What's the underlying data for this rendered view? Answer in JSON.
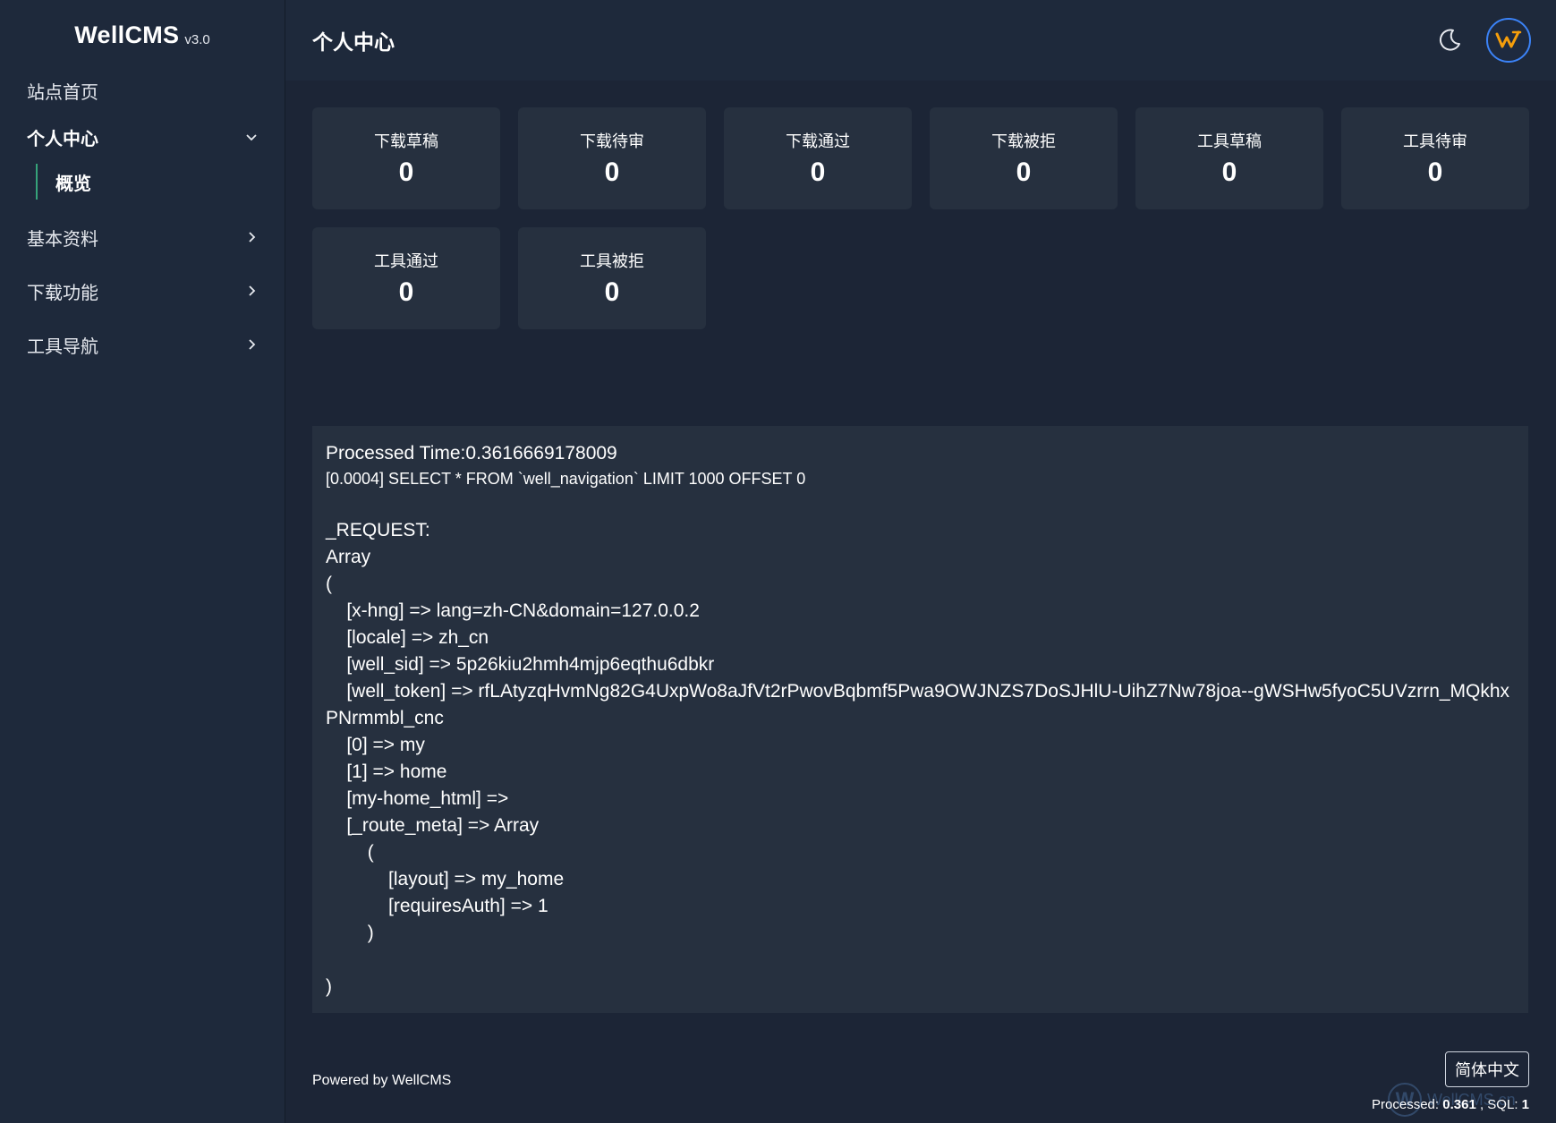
{
  "brand": {
    "name": "WellCMS",
    "version": "v3.0"
  },
  "sidebar": {
    "items": [
      {
        "label": "站点首页"
      },
      {
        "label": "个人中心",
        "sub": [
          {
            "label": "概览"
          }
        ]
      },
      {
        "label": "基本资料"
      },
      {
        "label": "下载功能"
      },
      {
        "label": "工具导航"
      }
    ]
  },
  "header": {
    "title": "个人中心"
  },
  "stats": [
    {
      "label": "下载草稿",
      "value": "0"
    },
    {
      "label": "下载待审",
      "value": "0"
    },
    {
      "label": "下载通过",
      "value": "0"
    },
    {
      "label": "下载被拒",
      "value": "0"
    },
    {
      "label": "工具草稿",
      "value": "0"
    },
    {
      "label": "工具待审",
      "value": "0"
    },
    {
      "label": "工具通过",
      "value": "0"
    },
    {
      "label": "工具被拒",
      "value": "0"
    }
  ],
  "debug": {
    "processed_time": "Processed Time:0.3616669178009",
    "sql": "[0.0004] SELECT * FROM `well_navigation` LIMIT 1000 OFFSET 0",
    "request_dump": "\n_REQUEST:\nArray\n(\n    [x-hng] => lang=zh-CN&domain=127.0.0.2\n    [locale] => zh_cn\n    [well_sid] => 5p26kiu2hmh4mjp6eqthu6dbkr\n    [well_token] => rfLAtyzqHvmNg82G4UxpWo8aJfVt2rPwovBqbmf5Pwa9OWJNZS7DoSJHlU-UihZ7Nw78joa--gWSHw5fyoC5UVzrrn_MQkhxPNrmmbl_cnc\n    [0] => my\n    [1] => home\n    [my-home_html] => \n    [_route_meta] => Array\n        (\n            [layout] => my_home\n            [requiresAuth] => 1\n        )\n\n)"
  },
  "footer": {
    "powered": "Powered by WellCMS",
    "language": "简体中文",
    "processed_label": "Processed: ",
    "processed_value": "0.361",
    "sql_label": " , SQL: ",
    "sql_value": "1",
    "watermark_letter": "W",
    "watermark_text": "WellCMS.cn"
  },
  "colors": {
    "sidebar_bg": "#1e293b",
    "main_bg": "#1c2536",
    "card_bg": "#26303f",
    "accent_green": "#36a37a",
    "avatar_ring": "#3b82f6",
    "logo_orange": "#f59e0b"
  },
  "icons": {
    "theme_toggle": "moon-icon",
    "avatar": "wellcms-logo-icon",
    "expand": "chevron-down-icon",
    "collapse": "chevron-right-icon"
  }
}
